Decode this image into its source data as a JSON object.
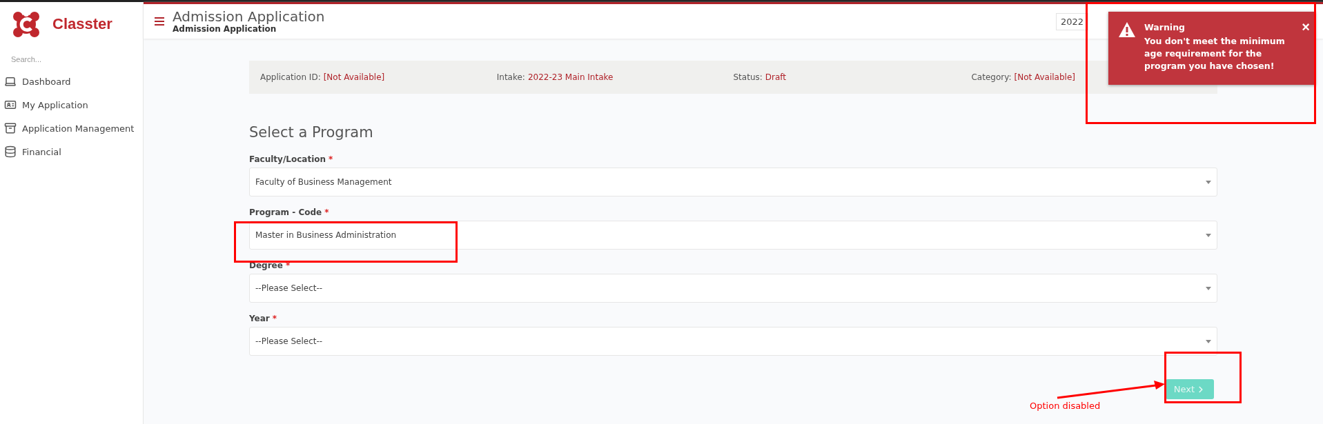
{
  "sidebar": {
    "brand": "Classter",
    "search": {
      "placeholder": "Search..."
    },
    "items": [
      {
        "label": "Dashboard"
      },
      {
        "label": "My Application"
      },
      {
        "label": "Application Management"
      },
      {
        "label": "Financial"
      }
    ]
  },
  "header": {
    "title": "Admission Application",
    "subtitle": "Admission Application",
    "year_select": "2022"
  },
  "info_bar": [
    {
      "label": "Application ID:",
      "value": "[Not Available]"
    },
    {
      "label": "Intake:",
      "value": "2022-23 Main Intake"
    },
    {
      "label": "Status:",
      "value": "Draft"
    },
    {
      "label": "Category:",
      "value": "[Not Available]"
    }
  ],
  "section_title": "Select a Program",
  "fields": [
    {
      "label": "Faculty/Location",
      "required_mark": "*",
      "value": "Faculty of Business Management"
    },
    {
      "label": "Program - Code",
      "required_mark": "*",
      "value": "Master in Business Administration"
    },
    {
      "label": "Degree",
      "required_mark": "*",
      "value": "--Please Select--"
    },
    {
      "label": "Year",
      "required_mark": "*",
      "value": "--Please Select--"
    }
  ],
  "next_button": {
    "label": "Next",
    "disabled": true
  },
  "toast": {
    "title": "Warning",
    "message": "You don't meet the minimum age requirement for the program you have chosen!",
    "close": "×"
  },
  "annotation": {
    "text": "Option disabled"
  }
}
